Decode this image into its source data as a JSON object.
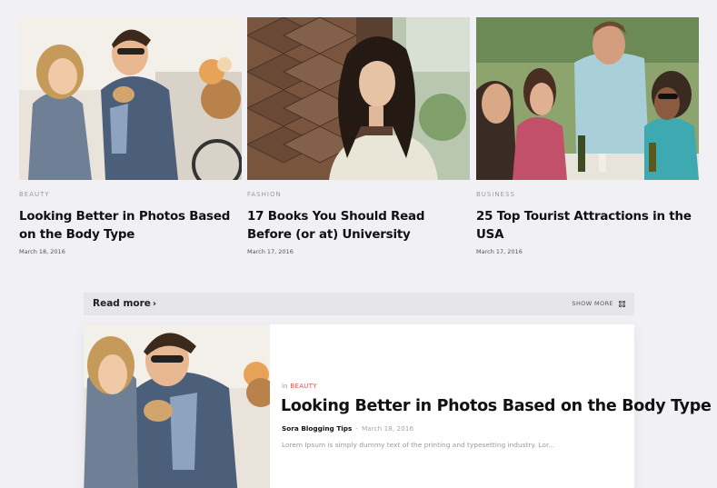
{
  "posts": [
    {
      "category": "BEAUTY",
      "title": "Looking Better in Photos Based on the Body Type",
      "date": "March 18, 2016",
      "image": "couple-with-bicycle-photo"
    },
    {
      "category": "FASHION",
      "title": "17 Books You Should Read Before (or at) University",
      "date": "March 17, 2016",
      "image": "woman-in-leather-chair-photo"
    },
    {
      "category": "BUSINESS",
      "title": "25 Top Tourist Attractions in the USA",
      "date": "March 17, 2016",
      "image": "friends-at-outdoor-dinner-photo"
    }
  ],
  "read_more": {
    "label": "Read more",
    "chevron": "›",
    "show_more": "SHOW MORE",
    "icon": "grid-icon"
  },
  "featured": {
    "in_label": "in",
    "category": "BEAUTY",
    "title": "Looking Better in Photos Based on the Body Type",
    "author": "Sora Blogging Tips",
    "separator": "-",
    "date": "March 18, 2016",
    "excerpt": "Lorem Ipsum is simply dummy text of the printing and typesetting industry. Lor..."
  },
  "colors": {
    "background": "#f1f0f5",
    "bar": "#e6e5ea",
    "accent": "#d9534f"
  }
}
